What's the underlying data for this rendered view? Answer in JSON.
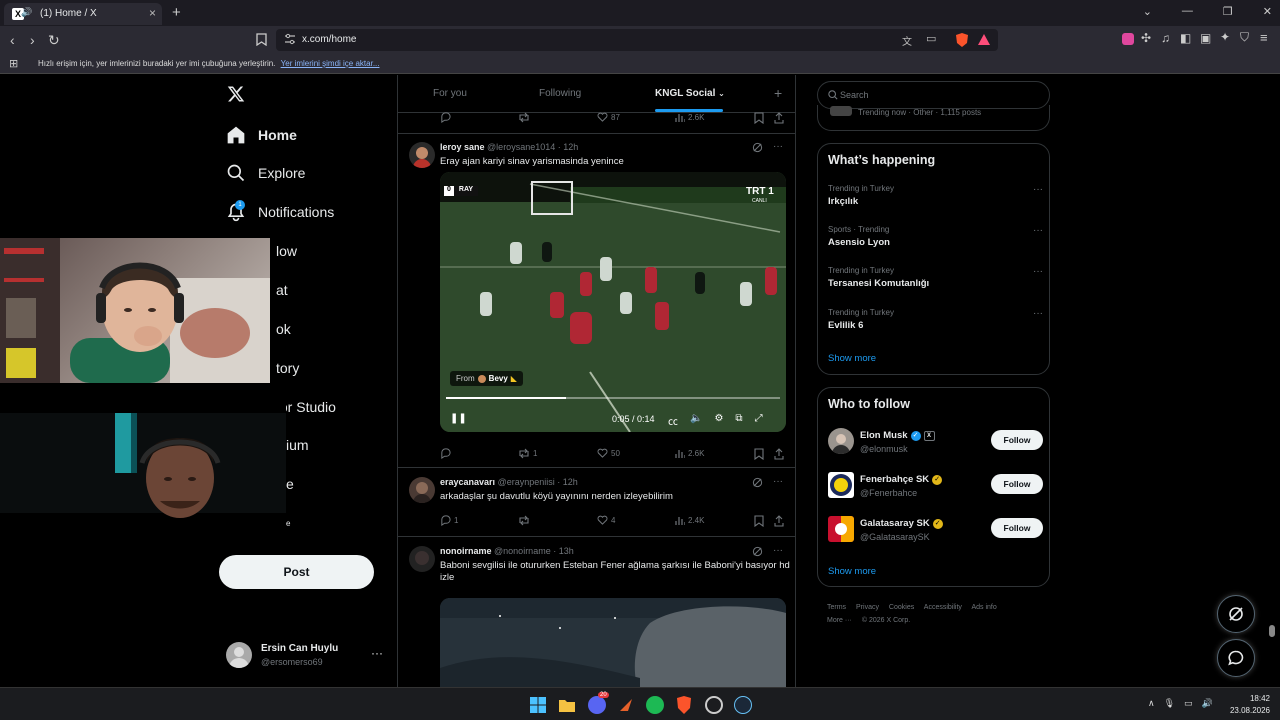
{
  "browser": {
    "tab_title": "(1) Home / X",
    "tab_icon": "x-logo-icon",
    "url": "x.com/home",
    "bookmark_message": "Hızlı erişim için, yer imlerinizi buradaki yer imi çubuğuna yerleştirin.",
    "bookmark_link": "Yer imlerini şimdi içe aktar..."
  },
  "sidebar": {
    "items": [
      {
        "label": "Home",
        "icon": "home-icon"
      },
      {
        "label": "Explore",
        "icon": "search-icon"
      },
      {
        "label": "Notifications",
        "icon": "bell-icon",
        "badge": "1"
      },
      {
        "label": "low",
        "icon": "follow-icon"
      },
      {
        "label": "at",
        "icon": "chat-icon"
      },
      {
        "label": "ok",
        "icon": "grok-icon"
      },
      {
        "label": "tory",
        "icon": "history-icon"
      },
      {
        "label": "tor Studio",
        "icon": "creator-studio-icon"
      },
      {
        "label": "ium",
        "icon": "premium-icon"
      },
      {
        "label": "e",
        "icon": "profile-icon"
      },
      {
        "label": "e",
        "icon": "more-icon"
      }
    ],
    "post_label": "Post",
    "account": {
      "name": "Ersin Can Huylu",
      "handle": "@ersomerso69",
      "more": "···"
    }
  },
  "feed": {
    "tabs": [
      {
        "label": "For you",
        "active": false
      },
      {
        "label": "Following",
        "active": false
      },
      {
        "label": "KNGL Social",
        "active": true
      }
    ],
    "tabs_plus": "+",
    "top_actions": {
      "replies": "",
      "reposts": "",
      "likes": "87",
      "views": "2.6K"
    },
    "tweets": [
      {
        "name": "leroy sane",
        "handle": "@leroysane1014",
        "time": "12h",
        "text": "Eray ajan kariyi sinav yarismasinda yenince",
        "video": {
          "from_label": "From",
          "from_name": "Bevy",
          "time": "0:05 / 0:14",
          "progress": 0.36,
          "channel": "TRT 1",
          "channel_sub": "CANLI",
          "score_left": "0",
          "score_team": "RAY"
        },
        "actions": {
          "replies": "",
          "reposts": "1",
          "likes": "50",
          "views": "2.6K"
        }
      },
      {
        "name": "eraycanavarı",
        "handle": "@eraynpeniisi",
        "time": "12h",
        "text": "arkadaşlar şu davutlu köyü yayınını nerden izleyebilirim",
        "actions": {
          "replies": "1",
          "reposts": "",
          "likes": "4",
          "views": "2.4K"
        }
      },
      {
        "name": "nonoirname",
        "handle": "@nonoirname",
        "time": "13h",
        "text": "Baboni sevgilisi ile otururken Esteban Fener ağlama şarkısı ile Baboni'yi basıyor hd izle"
      }
    ]
  },
  "right": {
    "search_placeholder": "Search",
    "prev_card_text": "Trending now · Other · 1,115 posts",
    "whats_happening": {
      "title": "What’s happening",
      "trends": [
        {
          "context": "Trending in Turkey",
          "name": "Irkçılık"
        },
        {
          "context": "Sports · Trending",
          "name": "Asensio Lyon"
        },
        {
          "context": "Trending in Turkey",
          "name": "Tersanesi Komutanlığı"
        },
        {
          "context": "Trending in Turkey",
          "name": "Evlilik 6"
        }
      ],
      "show_more": "Show more"
    },
    "who_to_follow": {
      "title": "Who to follow",
      "accounts": [
        {
          "name": "Elon Musk",
          "handle": "@elonmusk",
          "verified": "blue",
          "affiliate": "X"
        },
        {
          "name": "Fenerbahçe SK",
          "handle": "@Fenerbahce",
          "verified": "gold"
        },
        {
          "name": "Galatasaray SK",
          "handle": "@GalatasaraySK",
          "verified": "gold"
        }
      ],
      "follow_label": "Follow",
      "show_more": "Show more"
    },
    "footer": {
      "links": [
        "Terms",
        "Privacy",
        "Cookies",
        "Accessibility",
        "Ads info"
      ],
      "more": "More ···",
      "copyright": "© 2026 X Corp."
    }
  },
  "taskbar": {
    "time": "18:42",
    "date": "23.08.2026",
    "discord_badge": "20"
  },
  "colors": {
    "accent": "#1d9bf0",
    "background": "#000000",
    "text": "#e7e9ea",
    "muted": "#71767b",
    "border": "#2f3336",
    "gold_check": "#e2b719"
  }
}
